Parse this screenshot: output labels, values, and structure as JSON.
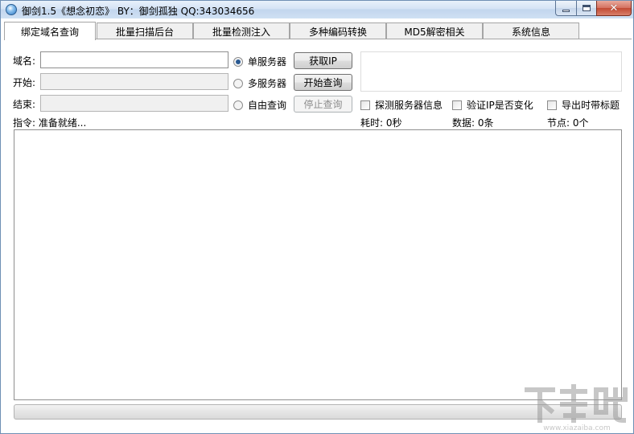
{
  "window": {
    "title": "御剑1.5《想念初恋》 BY：御剑孤独 QQ:343034656",
    "icon": "app-icon",
    "buttons": {
      "minimize": "minimize",
      "maximize": "maximize",
      "close": "close"
    }
  },
  "tabs": [
    {
      "label": "绑定域名查询",
      "active": true
    },
    {
      "label": "批量扫描后台",
      "active": false
    },
    {
      "label": "批量检测注入",
      "active": false
    },
    {
      "label": "多种编码转换",
      "active": false
    },
    {
      "label": "MD5解密相关",
      "active": false
    },
    {
      "label": "系统信息",
      "active": false
    }
  ],
  "form": {
    "domain_label": "域名:",
    "domain_value": "",
    "start_label": "开始:",
    "start_value": "",
    "end_label": "结束:",
    "end_value": "",
    "radios": [
      {
        "label": "单服务器",
        "checked": true
      },
      {
        "label": "多服务器",
        "checked": false
      },
      {
        "label": "自由查询",
        "checked": false
      }
    ],
    "buttons": {
      "get_ip": "获取IP",
      "start_query": "开始查询",
      "stop_query": "停止查询"
    },
    "checkboxes": [
      {
        "label": "探测服务器信息",
        "checked": false
      },
      {
        "label": "验证IP是否变化",
        "checked": false
      },
      {
        "label": "导出时带标题",
        "checked": false
      }
    ]
  },
  "status": {
    "command": "指令: 准备就绪...",
    "elapsed": "耗时: 0秒",
    "data_count": "数据: 0条",
    "nodes": "节点: 0个"
  },
  "progress": {
    "value": 0
  },
  "watermark": {
    "text": "下载吧",
    "domain": "www.xiazaiba.com"
  }
}
